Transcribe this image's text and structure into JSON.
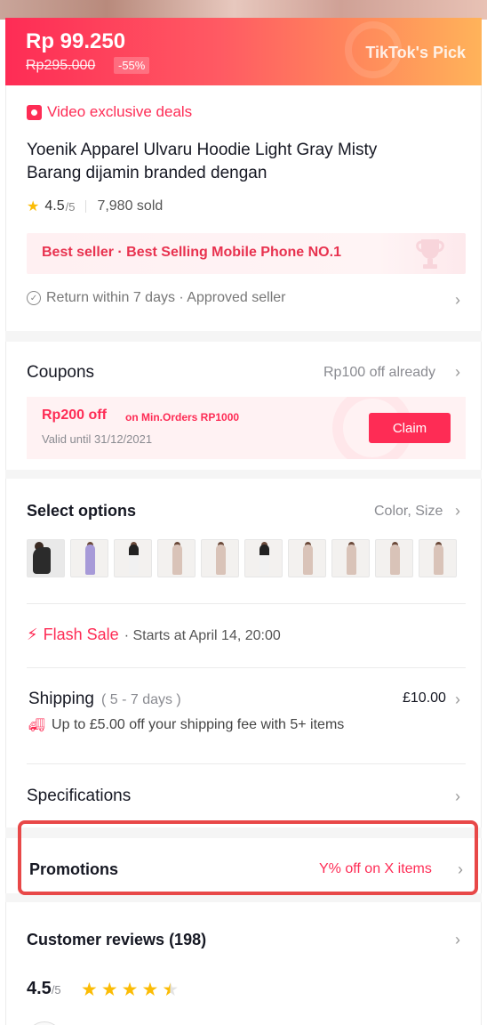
{
  "price_banner": {
    "price": "Rp 99.250",
    "original_price": "Rp295.000",
    "discount": "-55%",
    "pick_label": "TikTok's Pick"
  },
  "product": {
    "deal_label": "Video exclusive deals",
    "title": "Yoenik Apparel Ulvaru Hoodie Light Gray Misty Barang dijamin branded dengan",
    "rating": "4.5",
    "rating_max": "/5",
    "sold": "7,980 sold",
    "bestseller": "Best seller · Best Selling Mobile Phone  NO.1",
    "return_policy": "Return within 7 days · Approved seller"
  },
  "coupons": {
    "title": "Coupons",
    "summary": "Rp100 off already",
    "amount": "Rp200 off",
    "min_order": "on Min.Orders RP1000",
    "valid": "Valid until 31/12/2021",
    "claim_label": "Claim"
  },
  "options": {
    "title": "Select options",
    "summary": "Color, Size",
    "thumbnail_count": 10
  },
  "flash_sale": {
    "label": "Flash Sale",
    "starts": "· Starts at April 14, 20:00"
  },
  "shipping": {
    "title": "Shipping",
    "days": "( 5 - 7 days )",
    "price": "£10.00",
    "offer": "Up to £5.00 off your shipping fee with 5+ items"
  },
  "specifications": {
    "title": "Specifications"
  },
  "promotions": {
    "title": "Promotions",
    "value": "Y% off on X items"
  },
  "reviews": {
    "title": "Customer reviews (198)",
    "score": "4.5",
    "score_max": "/5",
    "stars": 4.5
  },
  "colors": {
    "accent": "#fe2c55",
    "highlight_border": "#e84848",
    "star": "#fbbc05"
  },
  "icons": {
    "deal": "shopping-bag-icon",
    "rating": "star-icon",
    "bestseller": "trophy-icon",
    "return": "check-circle-icon",
    "chevron": "chevron-right-icon",
    "flash": "lightning-bolt-icon",
    "shipping": "truck-icon"
  }
}
